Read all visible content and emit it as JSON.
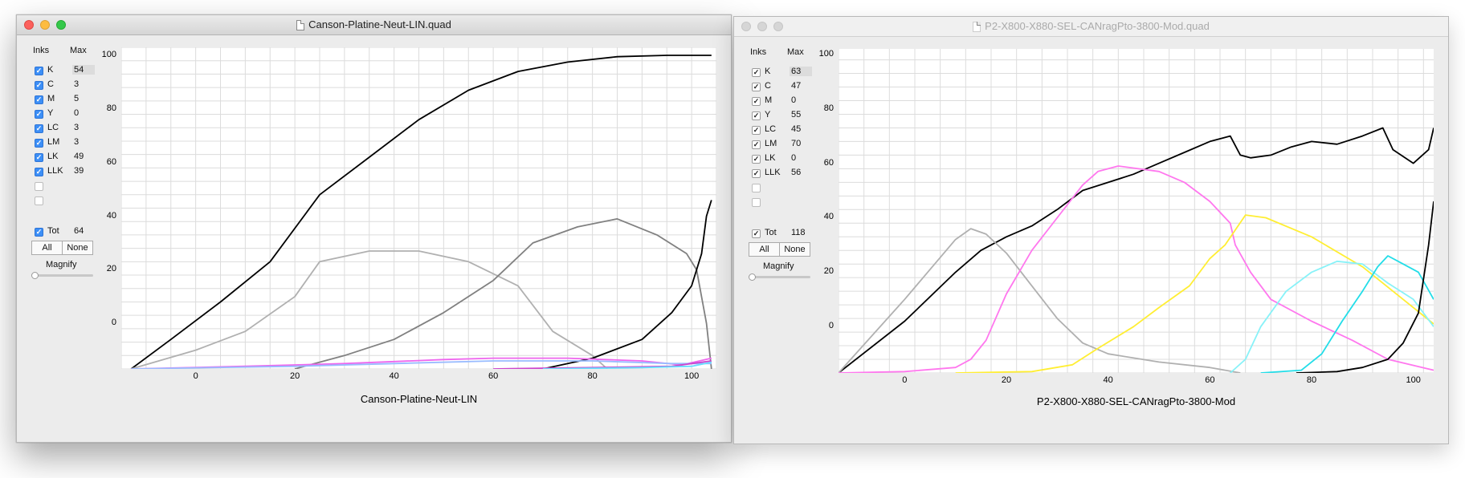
{
  "window1": {
    "title": "Canson-Platine-Neut-LIN.quad",
    "panel": {
      "inks_header": "Inks",
      "max_header": "Max",
      "inks": [
        {
          "name": "K",
          "max": "54",
          "checked": true
        },
        {
          "name": "C",
          "max": "3",
          "checked": true
        },
        {
          "name": "M",
          "max": "5",
          "checked": true
        },
        {
          "name": "Y",
          "max": "0",
          "checked": true
        },
        {
          "name": "LC",
          "max": "3",
          "checked": true
        },
        {
          "name": "LM",
          "max": "3",
          "checked": true
        },
        {
          "name": "LK",
          "max": "49",
          "checked": true
        },
        {
          "name": "LLK",
          "max": "39",
          "checked": true
        },
        {
          "name": "",
          "max": "",
          "checked": false
        },
        {
          "name": "",
          "max": "",
          "checked": false
        }
      ],
      "total_label": "Tot",
      "total_value": "64",
      "all_label": "All",
      "none_label": "None",
      "magnify_label": "Magnify",
      "magnify_value": 0
    },
    "chart_data": {
      "type": "line",
      "title": "Canson-Platine-Neut-LIN",
      "xlim": [
        -15,
        105
      ],
      "ylim": [
        -17,
        103
      ],
      "x_ticks": [
        0,
        20,
        40,
        60,
        80,
        100
      ],
      "y_ticks": [
        0,
        20,
        40,
        60,
        80,
        100
      ],
      "grid": true,
      "series": [
        {
          "color": "#000000",
          "points": [
            [
              -13,
              -17
            ],
            [
              -5,
              -6
            ],
            [
              5,
              8
            ],
            [
              15,
              23
            ],
            [
              25,
              48
            ],
            [
              35,
              62
            ],
            [
              45,
              76
            ],
            [
              55,
              87
            ],
            [
              65,
              94
            ],
            [
              75,
              97.5
            ],
            [
              85,
              99.5
            ],
            [
              95,
              100
            ],
            [
              104,
              100
            ]
          ]
        },
        {
          "color": "#b0b0b0",
          "points": [
            [
              -13,
              -17
            ],
            [
              0,
              -10
            ],
            [
              10,
              -3
            ],
            [
              20,
              10
            ],
            [
              25,
              23
            ],
            [
              35,
              27
            ],
            [
              45,
              27
            ],
            [
              55,
              23
            ],
            [
              65,
              14
            ],
            [
              72,
              -3
            ],
            [
              80,
              -12
            ],
            [
              83,
              -17
            ]
          ]
        },
        {
          "color": "#808080",
          "points": [
            [
              20,
              -17
            ],
            [
              30,
              -12
            ],
            [
              40,
              -6
            ],
            [
              50,
              4
            ],
            [
              60,
              16
            ],
            [
              68,
              30
            ],
            [
              77,
              36
            ],
            [
              85,
              39
            ],
            [
              93,
              33
            ],
            [
              99,
              26
            ],
            [
              101,
              20
            ],
            [
              103,
              0
            ],
            [
              104,
              -17
            ]
          ]
        },
        {
          "color": "#000000",
          "points": [
            [
              70,
              -17
            ],
            [
              80,
              -13
            ],
            [
              90,
              -6
            ],
            [
              96,
              4
            ],
            [
              100,
              14
            ],
            [
              102,
              26
            ],
            [
              103,
              40
            ],
            [
              104,
              46
            ]
          ]
        },
        {
          "color": "#ee66ee",
          "points": [
            [
              -13,
              -17
            ],
            [
              10,
              -16
            ],
            [
              30,
              -15
            ],
            [
              50,
              -13.5
            ],
            [
              60,
              -13
            ],
            [
              75,
              -13
            ],
            [
              90,
              -14
            ],
            [
              98,
              -15.5
            ],
            [
              104,
              -13
            ]
          ]
        },
        {
          "color": "#99bbff",
          "points": [
            [
              -13,
              -17
            ],
            [
              20,
              -16
            ],
            [
              40,
              -15
            ],
            [
              60,
              -14
            ],
            [
              80,
              -14
            ],
            [
              96,
              -15
            ],
            [
              104,
              -15
            ]
          ]
        },
        {
          "color": "#cc44cc",
          "points": [
            [
              60,
              -17
            ],
            [
              80,
              -16.5
            ],
            [
              96,
              -16
            ],
            [
              104,
              -14
            ]
          ]
        },
        {
          "color": "#66ddff",
          "points": [
            [
              70,
              -17
            ],
            [
              90,
              -16.5
            ],
            [
              100,
              -16
            ],
            [
              104,
              -14.5
            ]
          ]
        }
      ]
    }
  },
  "window2": {
    "title": "P2-X800-X880-SEL-CANragPto-3800-Mod.quad",
    "panel": {
      "inks_header": "Inks",
      "max_header": "Max",
      "inks": [
        {
          "name": "K",
          "max": "63",
          "checked": true
        },
        {
          "name": "C",
          "max": "47",
          "checked": true
        },
        {
          "name": "M",
          "max": "0",
          "checked": true
        },
        {
          "name": "Y",
          "max": "55",
          "checked": true
        },
        {
          "name": "LC",
          "max": "45",
          "checked": true
        },
        {
          "name": "LM",
          "max": "70",
          "checked": true
        },
        {
          "name": "LK",
          "max": "0",
          "checked": true
        },
        {
          "name": "LLK",
          "max": "56",
          "checked": true
        },
        {
          "name": "",
          "max": "",
          "checked": false
        },
        {
          "name": "",
          "max": "",
          "checked": false
        }
      ],
      "total_label": "Tot",
      "total_value": "118",
      "all_label": "All",
      "none_label": "None",
      "magnify_label": "Magnify",
      "magnify_value": 0
    },
    "chart_data": {
      "type": "line",
      "title": "P2-X800-X880-SEL-CANragPto-3800-Mod",
      "xlim": [
        -13,
        104
      ],
      "ylim": [
        -17,
        102
      ],
      "x_ticks": [
        0,
        20,
        40,
        60,
        80,
        100
      ],
      "y_ticks": [
        0,
        20,
        40,
        60,
        80,
        100
      ],
      "grid": true,
      "series": [
        {
          "color": "#000000",
          "points": [
            [
              -13,
              -17
            ],
            [
              0,
              2
            ],
            [
              10,
              20
            ],
            [
              15,
              28
            ],
            [
              20,
              33
            ],
            [
              25,
              37
            ],
            [
              30,
              43
            ],
            [
              35,
              50
            ],
            [
              40,
              53
            ],
            [
              45,
              56
            ],
            [
              50,
              60
            ],
            [
              55,
              64
            ],
            [
              60,
              68
            ],
            [
              64,
              70
            ],
            [
              66,
              63
            ],
            [
              68,
              62
            ],
            [
              72,
              63
            ],
            [
              76,
              66
            ],
            [
              80,
              68
            ],
            [
              85,
              67
            ],
            [
              90,
              70
            ],
            [
              94,
              73
            ],
            [
              96,
              65
            ],
            [
              100,
              60
            ],
            [
              103,
              65
            ],
            [
              104,
              73
            ]
          ]
        },
        {
          "color": "#b0b0b0",
          "points": [
            [
              -13,
              -17
            ],
            [
              0,
              10
            ],
            [
              10,
              32
            ],
            [
              13,
              36
            ],
            [
              16,
              34
            ],
            [
              20,
              27
            ],
            [
              25,
              15
            ],
            [
              30,
              3
            ],
            [
              35,
              -6
            ],
            [
              40,
              -10
            ],
            [
              50,
              -13
            ],
            [
              60,
              -15
            ],
            [
              66,
              -17
            ]
          ]
        },
        {
          "color": "#ff77ee",
          "points": [
            [
              -13,
              -17
            ],
            [
              0,
              -16.5
            ],
            [
              10,
              -15
            ],
            [
              13,
              -12
            ],
            [
              16,
              -5
            ],
            [
              20,
              12
            ],
            [
              25,
              28
            ],
            [
              30,
              40
            ],
            [
              35,
              52
            ],
            [
              38,
              57
            ],
            [
              42,
              59
            ],
            [
              50,
              57
            ],
            [
              55,
              53
            ],
            [
              60,
              46
            ],
            [
              64,
              38
            ],
            [
              65,
              30
            ],
            [
              68,
              20
            ],
            [
              72,
              10
            ],
            [
              80,
              2
            ],
            [
              88,
              -5
            ],
            [
              95,
              -12
            ],
            [
              104,
              -16
            ]
          ]
        },
        {
          "color": "#ffee33",
          "points": [
            [
              10,
              -17
            ],
            [
              25,
              -16.5
            ],
            [
              33,
              -14
            ],
            [
              38,
              -8
            ],
            [
              45,
              0
            ],
            [
              50,
              7
            ],
            [
              56,
              15
            ],
            [
              60,
              25
            ],
            [
              63,
              30
            ],
            [
              67,
              41
            ],
            [
              71,
              40
            ],
            [
              80,
              33
            ],
            [
              90,
              22
            ],
            [
              98,
              10
            ],
            [
              104,
              1
            ]
          ]
        },
        {
          "color": "#88f2f8",
          "points": [
            [
              64,
              -17
            ],
            [
              67,
              -12
            ],
            [
              70,
              0
            ],
            [
              75,
              13
            ],
            [
              80,
              20
            ],
            [
              85,
              24
            ],
            [
              90,
              23
            ],
            [
              95,
              16
            ],
            [
              100,
              10
            ],
            [
              104,
              0
            ]
          ]
        },
        {
          "color": "#22dde8",
          "points": [
            [
              70,
              -17
            ],
            [
              78,
              -16
            ],
            [
              82,
              -10
            ],
            [
              86,
              2
            ],
            [
              90,
              13
            ],
            [
              93,
              22
            ],
            [
              95,
              26
            ],
            [
              98,
              23
            ],
            [
              101,
              20
            ],
            [
              104,
              10
            ]
          ]
        },
        {
          "color": "#000000",
          "points": [
            [
              77,
              -17
            ],
            [
              85,
              -16.5
            ],
            [
              90,
              -15
            ],
            [
              95,
              -12
            ],
            [
              98,
              -6
            ],
            [
              101,
              5
            ],
            [
              103,
              30
            ],
            [
              104,
              46
            ]
          ]
        }
      ]
    }
  }
}
